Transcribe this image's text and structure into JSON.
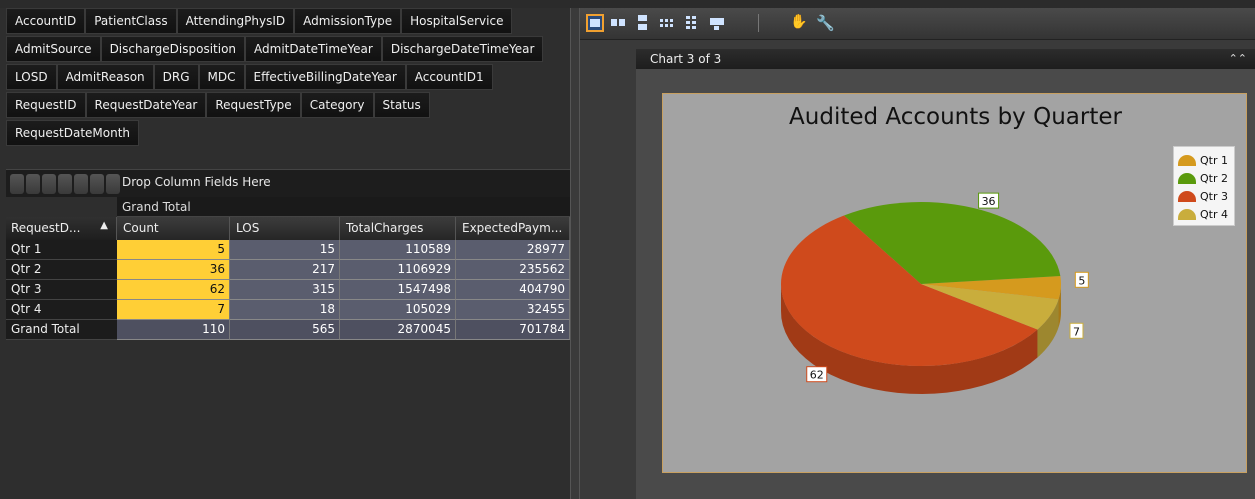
{
  "pivot": {
    "field_rows": [
      [
        "AccountID",
        "PatientClass",
        "AttendingPhysID",
        "AdmissionType",
        "HospitalService"
      ],
      [
        "AdmitSource",
        "DischargeDisposition",
        "AdmitDateTimeYear",
        "DischargeDateTimeYear"
      ],
      [
        "LOSD",
        "AdmitReason",
        "DRG",
        "MDC",
        "EffectiveBillingDateYear",
        "AccountID1"
      ],
      [
        "RequestID",
        "RequestDateYear",
        "RequestType",
        "Category",
        "Status"
      ],
      [
        "RequestDateMonth"
      ]
    ],
    "drop_label": "Drop Column Fields Here",
    "grand_total_header": "Grand Total",
    "row_field": "RequestD...",
    "sort_icon": "sort-asc-icon",
    "columns": [
      "Count",
      "LOS",
      "TotalCharges",
      "ExpectedPaym..."
    ],
    "rows": [
      {
        "label": "Qtr 1",
        "values": [
          "5",
          "15",
          "110589",
          "28977"
        ]
      },
      {
        "label": "Qtr 2",
        "values": [
          "36",
          "217",
          "1106929",
          "235562"
        ]
      },
      {
        "label": "Qtr 3",
        "values": [
          "62",
          "315",
          "1547498",
          "404790"
        ]
      },
      {
        "label": "Qtr 4",
        "values": [
          "7",
          "18",
          "105029",
          "32455"
        ]
      },
      {
        "label": "Grand Total",
        "values": [
          "110",
          "565",
          "2870045",
          "701784"
        ]
      }
    ]
  },
  "chart_pane": {
    "toolbar_icons": [
      "single-view-icon",
      "side-by-side-icon",
      "stacked-icon",
      "grid-view-icon",
      "tile-view-icon",
      "print-icon",
      "pan-hand-icon",
      "settings-wrench-icon"
    ],
    "header": "Chart 3 of 3",
    "collapse_icon": "collapse-up-icon"
  },
  "chart_data": {
    "type": "pie",
    "title": "Audited Accounts by Quarter",
    "categories": [
      "Qtr 1",
      "Qtr 2",
      "Qtr 3",
      "Qtr 4"
    ],
    "values": [
      5,
      36,
      62,
      7
    ],
    "data_labels": [
      "5",
      "36",
      "62",
      "7"
    ],
    "colors": [
      "#d59a1e",
      "#5a9a0c",
      "#cf4a1c",
      "#c9ad3c"
    ],
    "legend_position": "top-right",
    "three_d": true
  }
}
